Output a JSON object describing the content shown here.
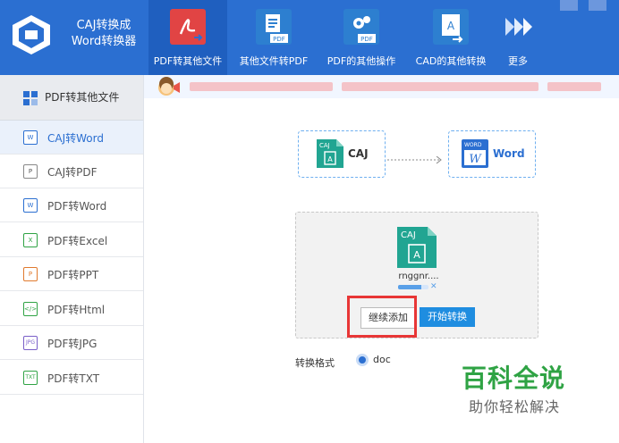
{
  "app": {
    "title_line1": "CAJ转换成",
    "title_line2": "Word转换器"
  },
  "toolbar": [
    {
      "label": "PDF转其他文件",
      "icon": "pdf-acrobat-icon",
      "active": true
    },
    {
      "label": "其他文件转PDF",
      "icon": "file-to-pdf-icon",
      "badge": "PDF"
    },
    {
      "label": "PDF的其他操作",
      "icon": "pdf-settings-icon",
      "badge": "PDF"
    },
    {
      "label": "CAD的其他转换",
      "icon": "cad-icon"
    },
    {
      "label": "更多",
      "icon": "more-arrows-icon"
    }
  ],
  "sidebar": {
    "header": "PDF转其他文件",
    "items": [
      {
        "label": "CAJ转Word",
        "icon_text": "W",
        "active": true
      },
      {
        "label": "CAJ转PDF",
        "icon_text": "P"
      },
      {
        "label": "PDF转Word",
        "icon_text": "W"
      },
      {
        "label": "PDF转Excel",
        "icon_text": "X"
      },
      {
        "label": "PDF转PPT",
        "icon_text": "P"
      },
      {
        "label": "PDF转Html",
        "icon_text": "</>"
      },
      {
        "label": "PDF转JPG",
        "icon_text": "JPG"
      },
      {
        "label": "PDF转TXT",
        "icon_text": "TXT"
      }
    ]
  },
  "flow": {
    "from_label": "CAJ",
    "from_icon_text": "CAJ",
    "to_label": "Word",
    "to_icon_text": "WORD",
    "to_icon_letter": "W"
  },
  "file": {
    "icon_text": "CAJ",
    "name": "rnggnr....",
    "progress": 0.75
  },
  "buttons": {
    "continue": "继续添加",
    "start": "开始转换"
  },
  "format": {
    "label": "转换格式",
    "option": "doc"
  },
  "watermark": {
    "title": "百科全说",
    "subtitle": "助你轻松解决"
  },
  "colors": {
    "brand": "#2b6fd1",
    "accent_green": "#2fa344",
    "highlight_red": "#e83636",
    "caj_teal": "#21a592"
  }
}
